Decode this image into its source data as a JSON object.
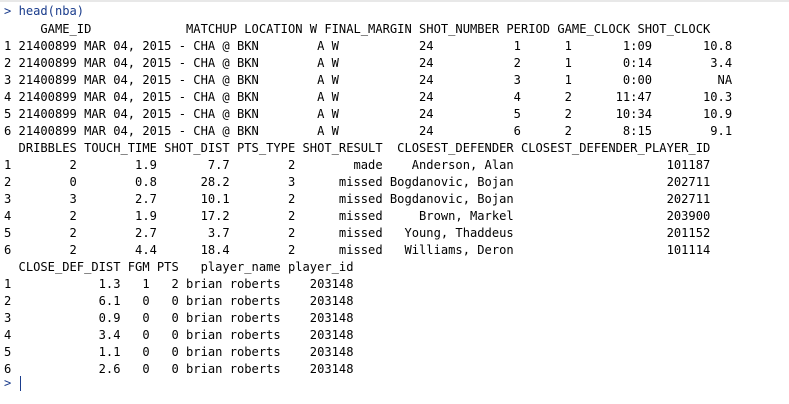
{
  "console": {
    "prompt_symbol": ">",
    "command": "head(nba)",
    "block1": {
      "header": "     GAME_ID             MATCHUP LOCATION W FINAL_MARGIN SHOT_NUMBER PERIOD GAME_CLOCK SHOT_CLOCK",
      "rows": [
        "1 21400899 MAR 04, 2015 - CHA @ BKN        A W           24           1      1       1:09       10.8",
        "2 21400899 MAR 04, 2015 - CHA @ BKN        A W           24           2      1       0:14        3.4",
        "3 21400899 MAR 04, 2015 - CHA @ BKN        A W           24           3      1       0:00         NA",
        "4 21400899 MAR 04, 2015 - CHA @ BKN        A W           24           4      2      11:47       10.3",
        "5 21400899 MAR 04, 2015 - CHA @ BKN        A W           24           5      2      10:34       10.9",
        "6 21400899 MAR 04, 2015 - CHA @ BKN        A W           24           6      2       8:15        9.1"
      ]
    },
    "block2": {
      "header": "  DRIBBLES TOUCH_TIME SHOT_DIST PTS_TYPE SHOT_RESULT  CLOSEST_DEFENDER CLOSEST_DEFENDER_PLAYER_ID",
      "rows": [
        "1        2        1.9       7.7        2        made    Anderson, Alan                     101187",
        "2        0        0.8      28.2        3      missed Bogdanovic, Bojan                     202711",
        "3        3        2.7      10.1        2      missed Bogdanovic, Bojan                     202711",
        "4        2        1.9      17.2        2      missed     Brown, Markel                     203900",
        "5        2        2.7       3.7        2      missed   Young, Thaddeus                     201152",
        "6        2        4.4      18.4        2      missed   Williams, Deron                     101114"
      ]
    },
    "block3": {
      "header": "  CLOSE_DEF_DIST FGM PTS   player_name player_id",
      "rows": [
        "1            1.3   1   2 brian roberts    203148",
        "2            6.1   0   0 brian roberts    203148",
        "3            0.9   0   0 brian roberts    203148",
        "4            3.4   0   0 brian roberts    203148",
        "5            1.1   0   0 brian roberts    203148",
        "6            2.6   0   0 brian roberts    203148"
      ]
    },
    "final_prompt": ">"
  },
  "colors": {
    "prompt": "#1a3c8c",
    "output": "#000000",
    "background": "#ffffff"
  }
}
